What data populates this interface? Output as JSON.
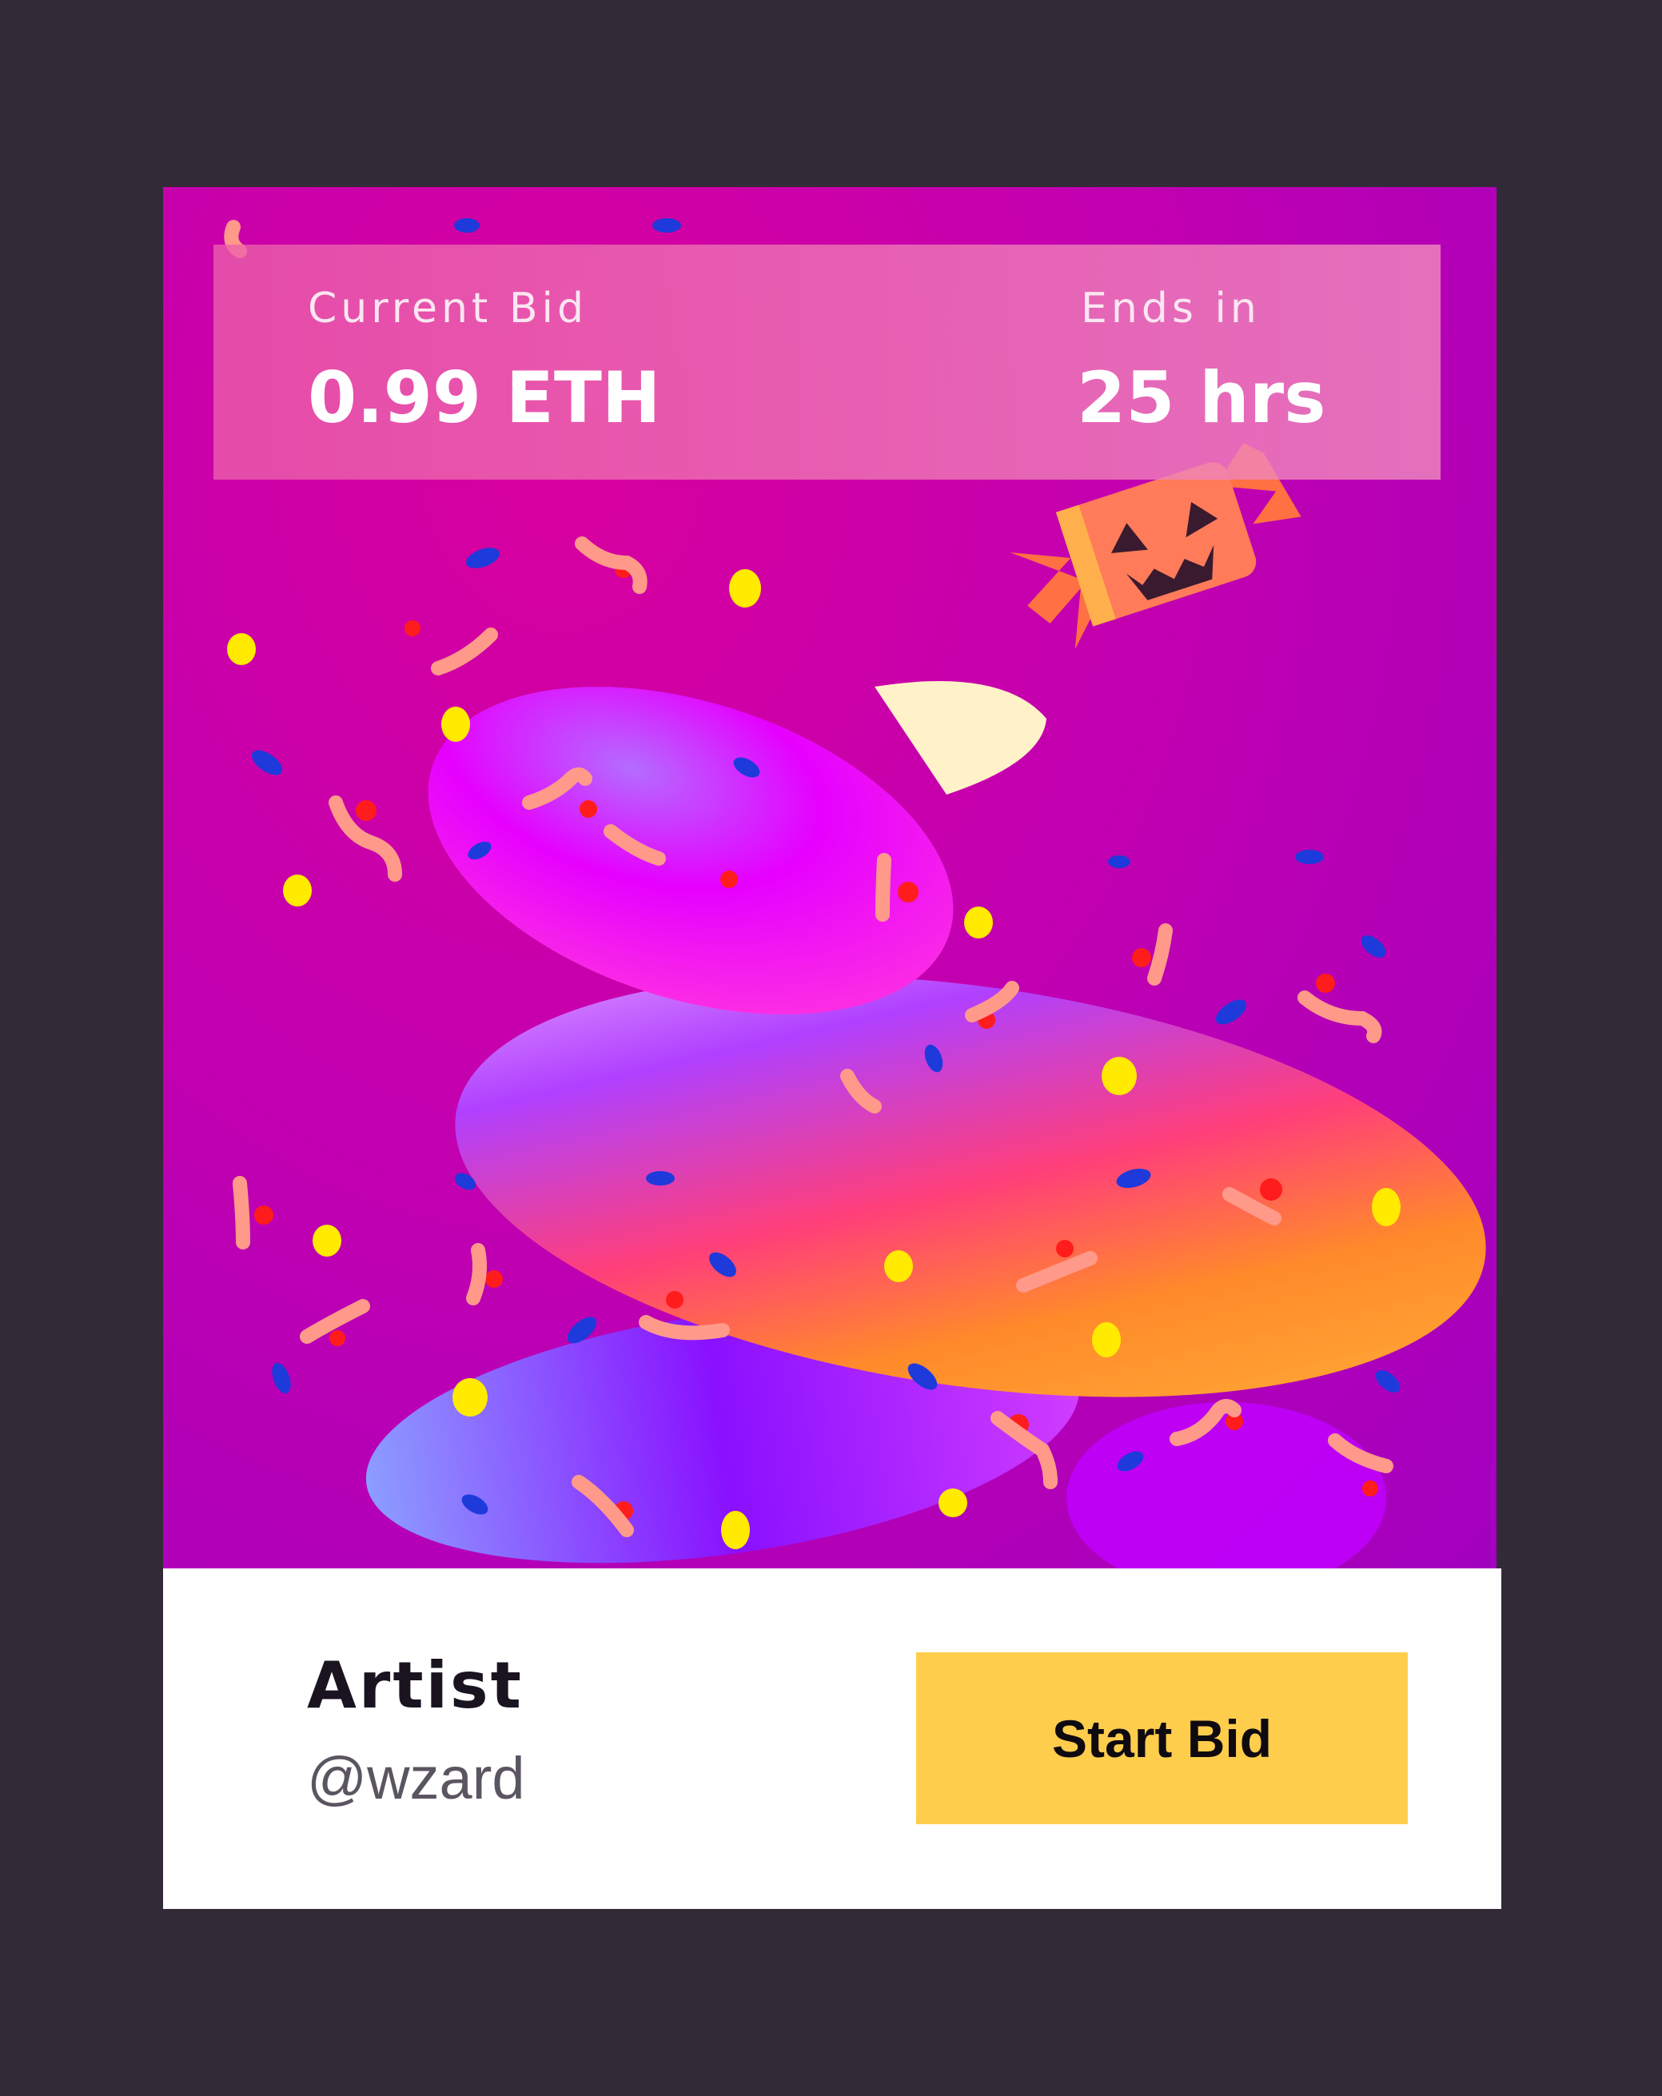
{
  "card": {
    "current_bid_label": "Current Bid",
    "current_bid_value": "0.99 ETH",
    "ends_in_label": "Ends in",
    "ends_in_value": "25 hrs",
    "artist_label": "Artist",
    "artist_handle": "@wzard",
    "start_bid_label": "Start Bid"
  },
  "artwork": {
    "description_icons": [
      "candy-pumpkin-icon",
      "gummy-worm-icon",
      "sprinkle-icon"
    ]
  },
  "colors": {
    "background": "#332a37",
    "button": "#fecd4c",
    "footer": "#ffffff"
  }
}
